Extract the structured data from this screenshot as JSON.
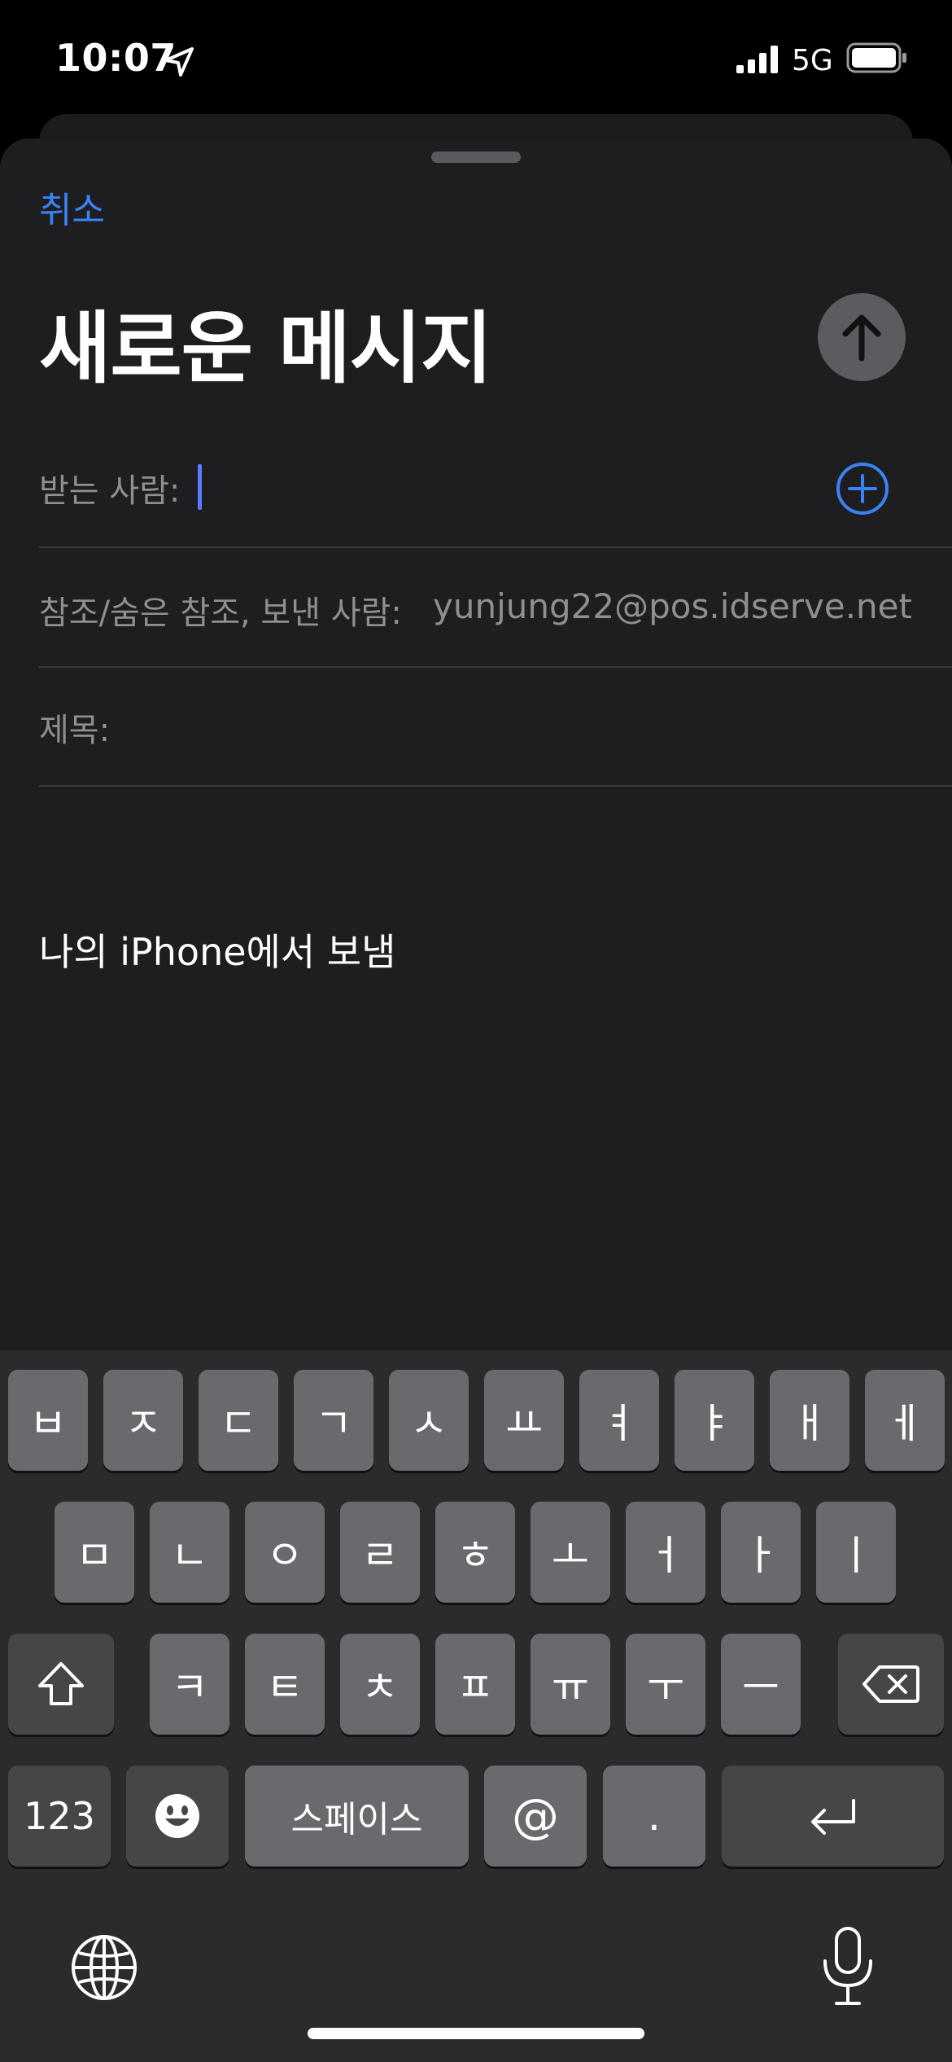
{
  "status_bar": {
    "time": "10:07",
    "network": "5G"
  },
  "compose": {
    "cancel_label": "취소",
    "title": "새로운 메시지",
    "to_label": "받는 사람:",
    "cc_label": "참조/숨은 참조, 보낸 사람:",
    "from_value": "yunjung22@pos.idserve.net",
    "subject_label": "제목:",
    "signature": "나의 iPhone에서 보냄"
  },
  "keyboard": {
    "row1": [
      "ㅂ",
      "ㅈ",
      "ㄷ",
      "ㄱ",
      "ㅅ",
      "ㅛ",
      "ㅕ",
      "ㅑ",
      "ㅐ",
      "ㅔ"
    ],
    "row2": [
      "ㅁ",
      "ㄴ",
      "ㅇ",
      "ㄹ",
      "ㅎ",
      "ㅗ",
      "ㅓ",
      "ㅏ",
      "ㅣ"
    ],
    "row3": [
      "ㅋ",
      "ㅌ",
      "ㅊ",
      "ㅍ",
      "ㅠ",
      "ㅜ",
      "ㅡ"
    ],
    "numbers_label": "123",
    "space_label": "스페이스",
    "at_label": "@",
    "period_label": "."
  },
  "colors": {
    "accent": "#3b82f6",
    "caret": "#5b7cff",
    "sheet": "#1e1e20",
    "key": "#6a6a6e",
    "key_dark": "#464649"
  }
}
